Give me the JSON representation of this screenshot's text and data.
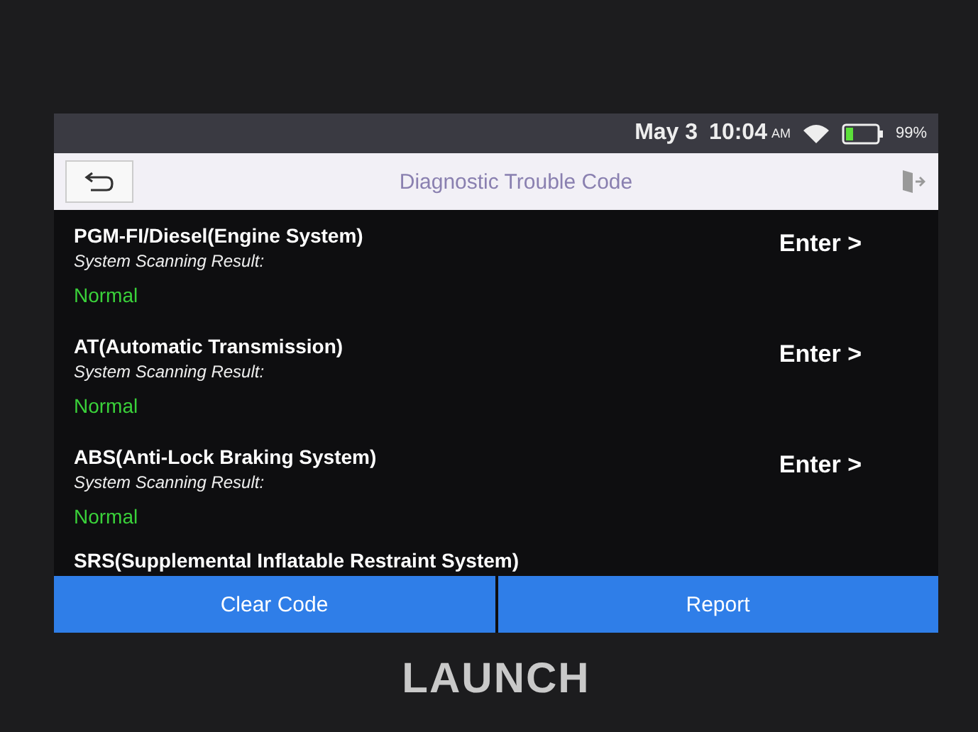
{
  "status_bar": {
    "date": "May 3",
    "time": "10:04",
    "ampm": "AM",
    "battery": "99%"
  },
  "title_bar": {
    "title": "Diagnostic Trouble Code"
  },
  "systems": [
    {
      "name": "PGM-FI/Diesel(Engine System)",
      "result_label": "System Scanning Result:",
      "result": "Normal",
      "action": "Enter >"
    },
    {
      "name": "AT(Automatic Transmission)",
      "result_label": "System Scanning Result:",
      "result": "Normal",
      "action": "Enter >"
    },
    {
      "name": "ABS(Anti-Lock Braking System)",
      "result_label": "System Scanning Result:",
      "result": "Normal",
      "action": "Enter >"
    },
    {
      "name": "SRS(Supplemental Inflatable Restraint System)"
    }
  ],
  "buttons": [
    "Clear Code",
    "Report"
  ],
  "brand": "LAUNCH"
}
